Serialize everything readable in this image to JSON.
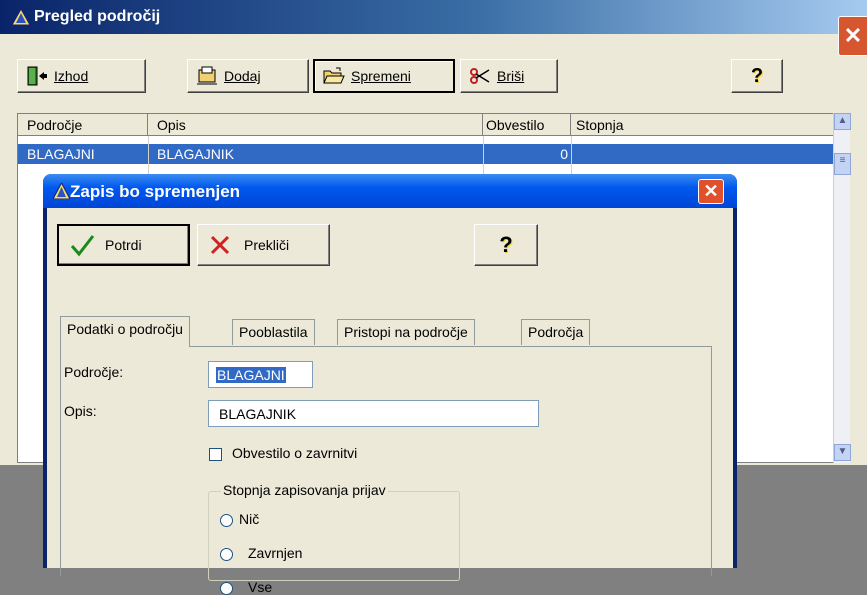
{
  "main_window": {
    "title": "Pregled področij",
    "toolbar": {
      "exit_label": "Izhod",
      "add_label": "Dodaj",
      "edit_label": "Spremeni",
      "delete_label": "Briši",
      "help_icon": "question-key-icon"
    },
    "grid": {
      "columns": [
        "Področje",
        "Opis",
        "Obvestilo",
        "Stopnja"
      ],
      "rows": [
        {
          "area": "BLAGAJNI",
          "description": "BLAGAJNIK",
          "notice": "0",
          "level": "",
          "selected": true
        }
      ]
    }
  },
  "dialog": {
    "title": "Zapis bo spremenjen",
    "buttons": {
      "confirm_label": "Potrdi",
      "cancel_label": "Prekliči",
      "help_icon": "question-key-icon"
    },
    "tabs": [
      "Podatki o področju",
      "Pooblastila",
      "Pristopi na področje",
      "Področja"
    ],
    "active_tab": 0,
    "fields": {
      "area_label": "Področje:",
      "area_value": "BLAGAJNI",
      "description_label": "Opis:",
      "description_value": "BLAGAJNIK",
      "notify_label": "Obvestilo o zavrnitvi",
      "notify_checked": false
    },
    "level_group": {
      "title": "Stopnja zapisovanja prijav",
      "options": [
        "Nič",
        "Zavrnjen",
        "Vse"
      ],
      "selected": null
    }
  },
  "colors": {
    "selection": "#316ac5",
    "dialog_titlebar": "#0058ee",
    "close_button": "#e0512b",
    "face": "#ece9d8"
  }
}
